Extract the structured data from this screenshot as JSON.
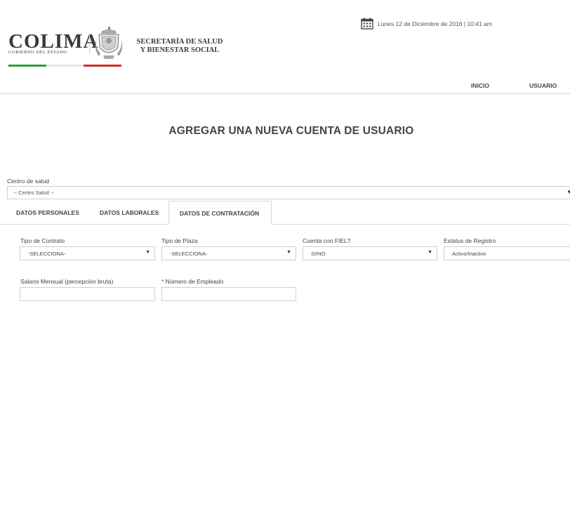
{
  "header": {
    "logo_text": "COLIMA",
    "logo_subtitle": "GOBIERNO DEL ESTADO",
    "secretaria_line1": "SECRETARÍA DE SALUD",
    "secretaria_line2": "Y BIENESTAR SOCIAL",
    "date": "Lunes 12 de Diciembre de 2016 | 10:41 am",
    "flag_colors": [
      "#2e9e3e",
      "#e6e6e6",
      "#d42a2a"
    ]
  },
  "nav": {
    "items": [
      {
        "label": "INICIO"
      },
      {
        "label": "USUARIO"
      }
    ]
  },
  "page_title": "AGREGAR UNA NUEVA CUENTA DE USUARIO",
  "centro_salud": {
    "label": "Centro de salud",
    "selected": "-- Centro Salud --"
  },
  "tabs": [
    {
      "label": "DATOS PERSONALES",
      "active": false
    },
    {
      "label": "DATOS LABORALES",
      "active": false
    },
    {
      "label": "DATOS DE CONTRATACIÓN",
      "active": true
    }
  ],
  "form": {
    "tipo_contrato": {
      "label": "Tipo de Contrato",
      "selected": "-SELECCIONA-"
    },
    "tipo_plaza": {
      "label": "Tipo de Plaza",
      "selected": "-SELECCIONA-"
    },
    "cuenta_fiel": {
      "label": "Cuenta con FIEL?",
      "selected": "SI/NO"
    },
    "estatus_registro": {
      "label": "Estatus de Registro",
      "selected": "Activo/Inactivo"
    },
    "salario": {
      "label": "Salario Mensual (percepción bruta)",
      "value": ""
    },
    "numero_empleado": {
      "required_mark": "*",
      "label": " Número de Empleado",
      "value": ""
    }
  }
}
